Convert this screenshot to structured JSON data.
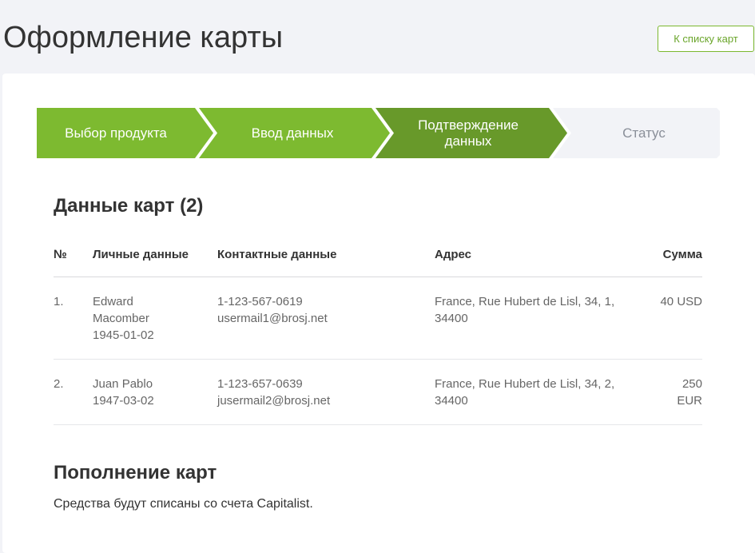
{
  "page": {
    "title": "Оформление карты",
    "back_button": "К списку карт"
  },
  "stepper": {
    "steps": [
      {
        "label": "Выбор продукта",
        "state": "done"
      },
      {
        "label": "Ввод данных",
        "state": "done"
      },
      {
        "label": "Подтверждение данных",
        "state": "active"
      },
      {
        "label": "Статус",
        "state": "future"
      }
    ],
    "colors": {
      "done": "#7dba30",
      "active": "#68992a",
      "future": "#f2f3f7"
    }
  },
  "cards_section": {
    "title": "Данные карт (2)",
    "columns": [
      "№",
      "Личные данные",
      "Контактные данные",
      "Адрес",
      "Сумма"
    ],
    "rows": [
      {
        "num": "1.",
        "person": [
          "Edward",
          "Macomber",
          "1945-01-02"
        ],
        "contact": [
          "1-123-567-0619",
          "usermail1@brosj.net"
        ],
        "address": "France, Rue Hubert de Lisl, 34, 1, 34400",
        "sum": "40 USD"
      },
      {
        "num": "2.",
        "person": [
          "Juan Pablo",
          "1947-03-02"
        ],
        "contact": [
          "1-123-657-0639",
          "jusermail2@brosj.net"
        ],
        "address": "France, Rue Hubert de Lisl, 34, 2, 34400",
        "sum": "250 EUR"
      }
    ]
  },
  "topup_section": {
    "title": "Пополнение карт",
    "text": "Средства будут списаны со счета Capitalist."
  }
}
